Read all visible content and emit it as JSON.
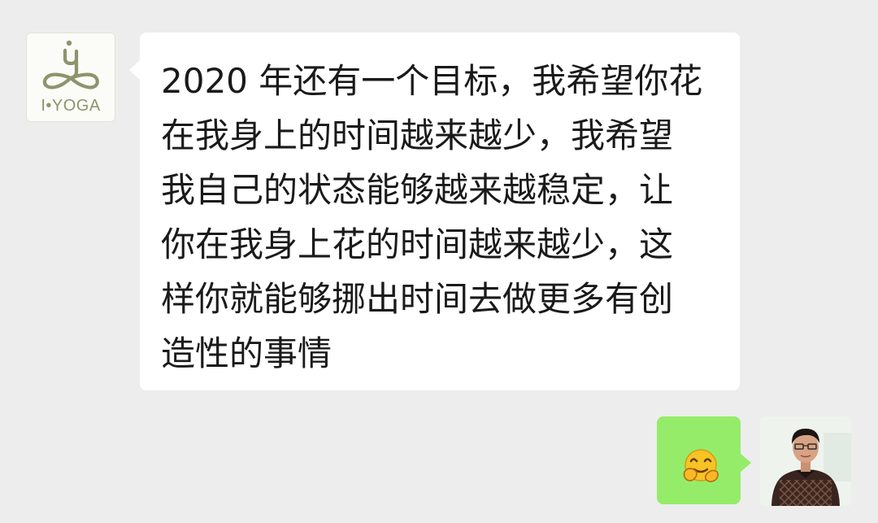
{
  "chat": {
    "incoming": {
      "avatar_icon": "i-yoga-logo",
      "avatar_label": "I•YOGA",
      "message_text": "2020 年还有一个目标，我希望你花\n在我身上的时间越来越少，我希望\n我自己的状态能够越来越稳定，让\n你在我身上花的时间越来越少，这\n样你就能够挪出时间去做更多有创\n造性的事情"
    },
    "outgoing": {
      "emoji_icon": "hugging-face-emoji",
      "avatar_icon": "user-photo-avatar"
    }
  },
  "colors": {
    "background": "#ededed",
    "incoming_bubble": "#ffffff",
    "outgoing_bubble": "#95ec69",
    "logo": "#8e946b",
    "text": "#1a1a1a"
  }
}
